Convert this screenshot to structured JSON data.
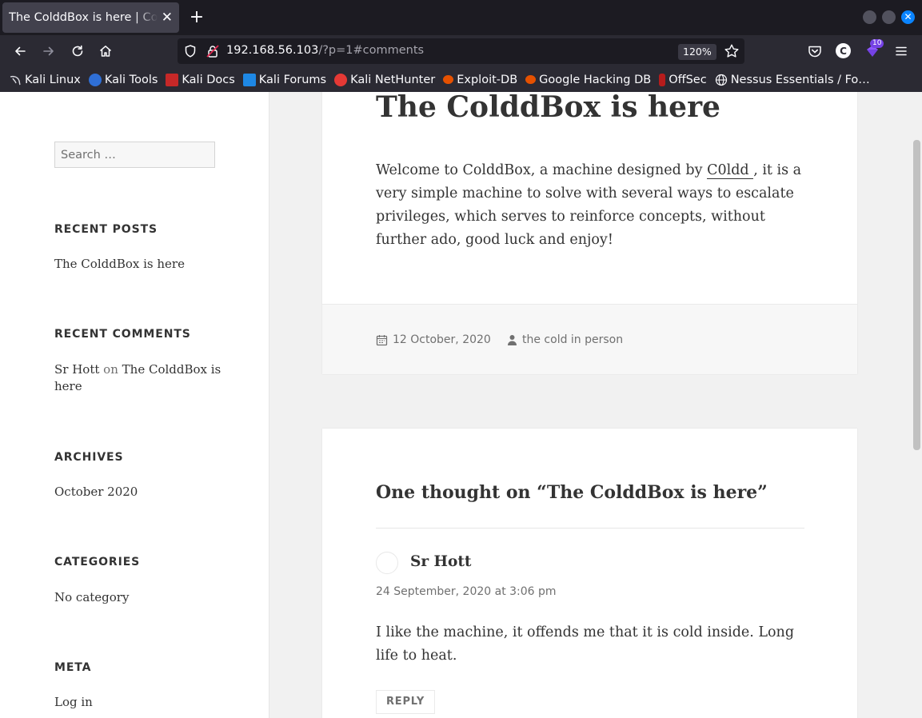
{
  "browser": {
    "tab": {
      "title": "The ColddBox is here | ColddBox",
      "close": "✕"
    },
    "new_tab": "+",
    "url_host": "192.168.56.103",
    "url_rest": "/?p=1#comments",
    "zoom": "120%",
    "extension_badge": "10",
    "account_initial": "C"
  },
  "bookmarks": [
    {
      "label": "Kali Linux",
      "color": "#3d8fd6"
    },
    {
      "label": "Kali Tools",
      "color": "#d32f2f"
    },
    {
      "label": "Kali Docs",
      "color": "#c62828"
    },
    {
      "label": "Kali Forums",
      "color": "#1e88e5"
    },
    {
      "label": "Kali NetHunter",
      "color": "#e53935"
    },
    {
      "label": "Exploit-DB",
      "color": "#e65100"
    },
    {
      "label": "Google Hacking DB",
      "color": "#e65100"
    },
    {
      "label": "OffSec",
      "color": "#b71c1c"
    },
    {
      "label": "Nessus Essentials / Fo…",
      "color": "#9e9e9e"
    }
  ],
  "sidebar": {
    "search_placeholder": "Search …",
    "recent_posts": {
      "title": "RECENT POSTS",
      "items": [
        "The ColddBox is here"
      ]
    },
    "recent_comments": {
      "title": "RECENT COMMENTS",
      "author": "Sr Hott",
      "on": "on",
      "post": "The ColddBox is here"
    },
    "archives": {
      "title": "ARCHIVES",
      "items": [
        "October 2020"
      ]
    },
    "categories": {
      "title": "CATEGORIES",
      "items": [
        "No category"
      ]
    },
    "meta": {
      "title": "META",
      "items": [
        "Log in"
      ]
    }
  },
  "post": {
    "title": "The ColddBox is here",
    "body_before": "Welcome to ColddBox, a machine designed by ",
    "body_author_link": "C0ldd ",
    "body_after": ", it is a very simple machine to solve with several ways to esca­late privileges, which serves to reinforce concepts, with­out further ado, good luck and enjoy!",
    "date": "12 October, 2020",
    "author": "the cold in person"
  },
  "comments": {
    "title": "One thought on “The ColddBox is here”",
    "items": [
      {
        "author": "Sr Hott",
        "date": "24 September, 2020 at 3:06 pm",
        "body": "I like the machine, it offends me that it is cold inside. Long life to heat.",
        "reply": "REPLY"
      }
    ]
  },
  "colors": {
    "accent": "#0a84ff",
    "chrome": "#2b2a33",
    "page_bg": "#f1f1f1"
  }
}
